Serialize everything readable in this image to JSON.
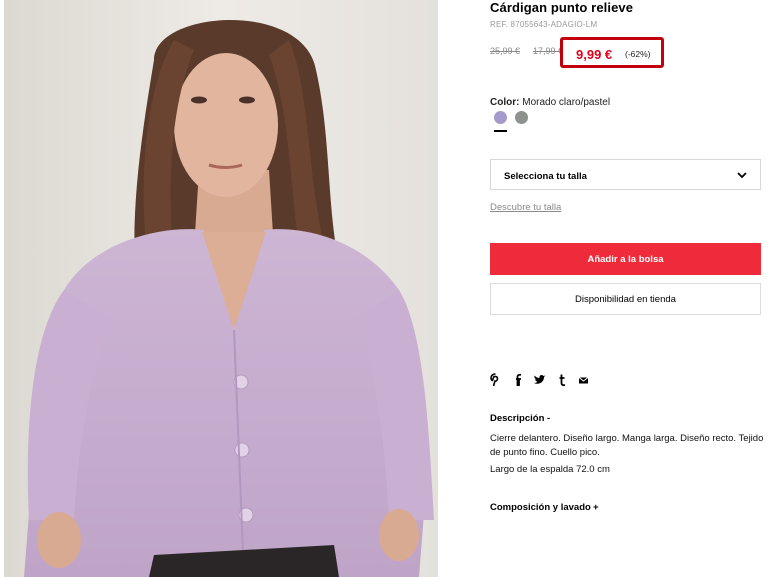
{
  "product": {
    "title": "Cárdigan punto relieve",
    "ref": "REF. 87055643-ADAGIO-LM",
    "original_price": "25,99 €",
    "previous_price": "17,99 €",
    "current_price": "9,99 €",
    "discount": "(-62%)",
    "price_highlight_color": "#c2000b"
  },
  "color": {
    "label": "Color:",
    "value": "Morado claro/pastel",
    "swatches": [
      {
        "name": "lilac",
        "hex": "#a59ac9",
        "selected": true
      },
      {
        "name": "grey-green",
        "hex": "#8b938c",
        "selected": false
      }
    ]
  },
  "size": {
    "placeholder": "Selecciona tu talla",
    "guide_link": "Descubre tu talla"
  },
  "actions": {
    "add_to_bag": "Añadir a la bolsa",
    "store_availability": "Disponibilidad en tienda",
    "accent_color": "#ef2b3b"
  },
  "share_icons": [
    "pinterest-icon",
    "facebook-icon",
    "twitter-icon",
    "tumblr-icon",
    "email-icon"
  ],
  "description": {
    "title": "Descripción",
    "toggle": "-",
    "text": "Cierre delantero. Diseño largo. Manga larga. Diseño recto. Tejido de punto fino. Cuello pico.",
    "length": "Largo de la espalda 72.0 cm"
  },
  "composition": {
    "title": "Composición y lavado",
    "toggle": "+"
  }
}
